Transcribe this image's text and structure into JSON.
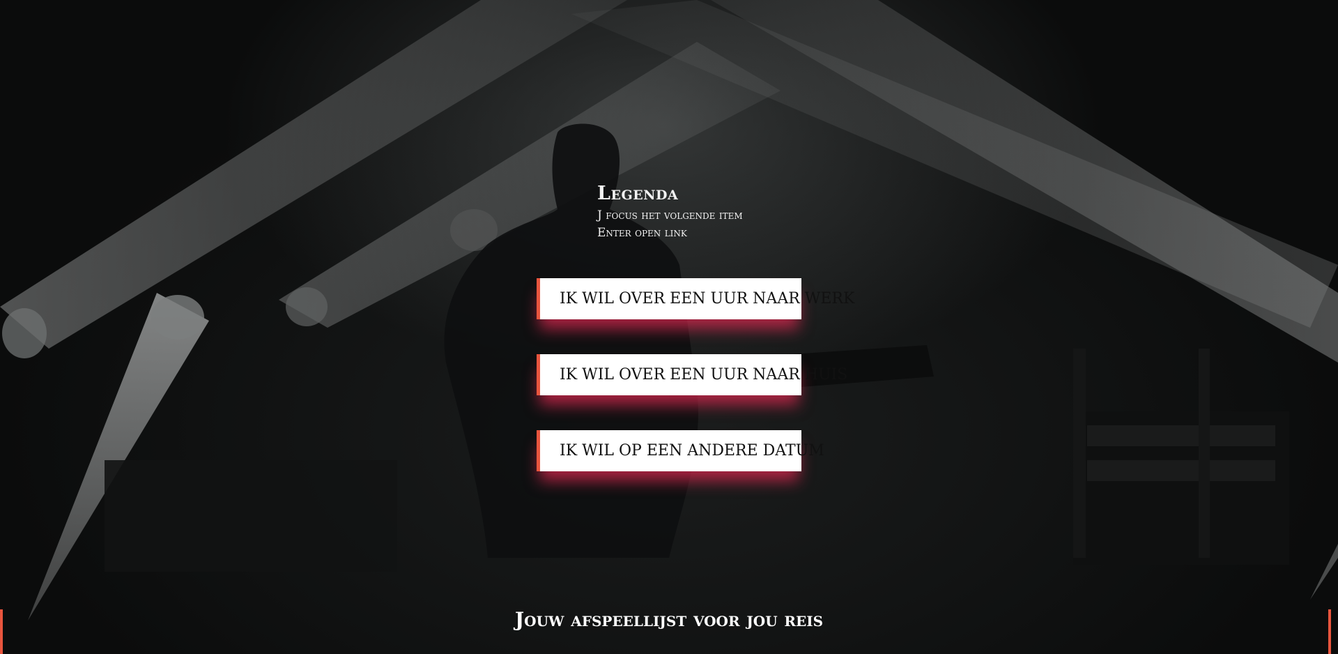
{
  "legend": {
    "title": "Legenda",
    "lines": [
      "J focus het volgende item",
      "Enter open link"
    ]
  },
  "options": [
    {
      "label": "IK WIL OVER EEN UUR NAAR WERK"
    },
    {
      "label": "IK WIL OVER EEN UUR NAAR HUIS"
    },
    {
      "label": "IK WIL OP EEN ANDERE DATUM"
    }
  ],
  "footer": {
    "title": "Jouw afspeellijst voor jou reis"
  },
  "colors": {
    "accent": "#e8553e",
    "glow": "#dc2850",
    "card": "#ffffff",
    "text_light": "#ffffff"
  }
}
